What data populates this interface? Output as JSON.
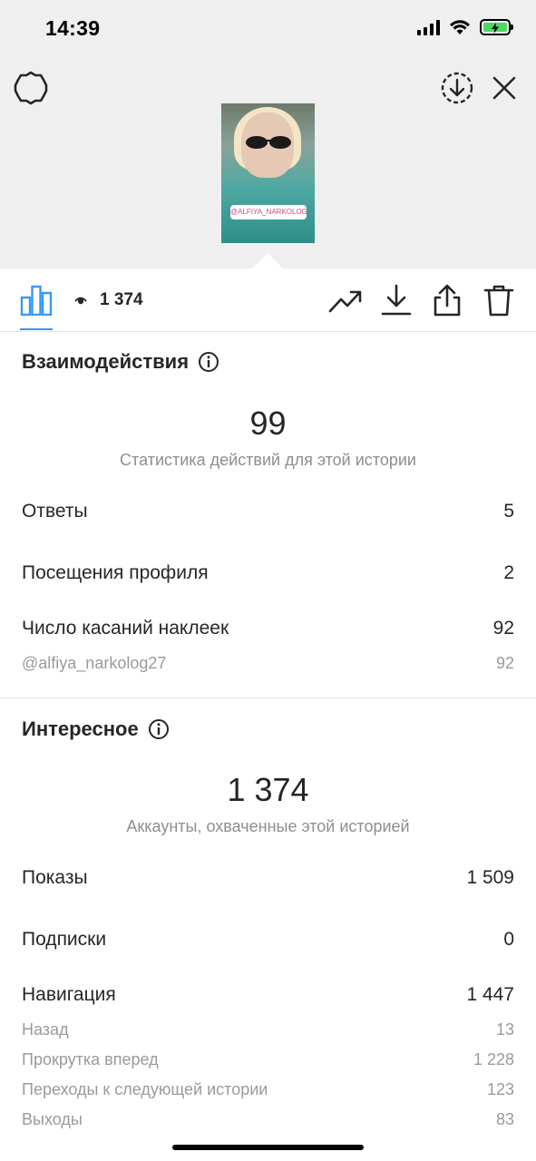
{
  "status_bar": {
    "time": "14:39"
  },
  "toolbar": {
    "views_count": "1 374"
  },
  "story_preview": {
    "sticker_text": "@ALFIYA_NARKOLOG27"
  },
  "interactions": {
    "title": "Взаимодействия",
    "total": "99",
    "caption": "Статистика действий для этой истории",
    "rows": [
      {
        "label": "Ответы",
        "value": "5"
      },
      {
        "label": "Посещения профиля",
        "value": "2"
      },
      {
        "label": "Число касаний наклеек",
        "value": "92"
      }
    ],
    "sticker_row": {
      "label": "@alfiya_narkolog27",
      "value": "92"
    }
  },
  "discovery": {
    "title": "Интересное",
    "total": "1 374",
    "caption": "Аккаунты, охваченные этой историей",
    "rows": [
      {
        "label": "Показы",
        "value": "1 509"
      },
      {
        "label": "Подписки",
        "value": "0"
      },
      {
        "label": "Навигация",
        "value": "1 447"
      }
    ],
    "navigation_subrows": [
      {
        "label": "Назад",
        "value": "13"
      },
      {
        "label": "Прокрутка вперед",
        "value": "1 228"
      },
      {
        "label": "Переходы к следующей истории",
        "value": "123"
      },
      {
        "label": "Выходы",
        "value": "83"
      }
    ]
  },
  "colors": {
    "accent": "#3897f0",
    "muted_text": "#8e8e8e",
    "battery": "#4cd964"
  }
}
